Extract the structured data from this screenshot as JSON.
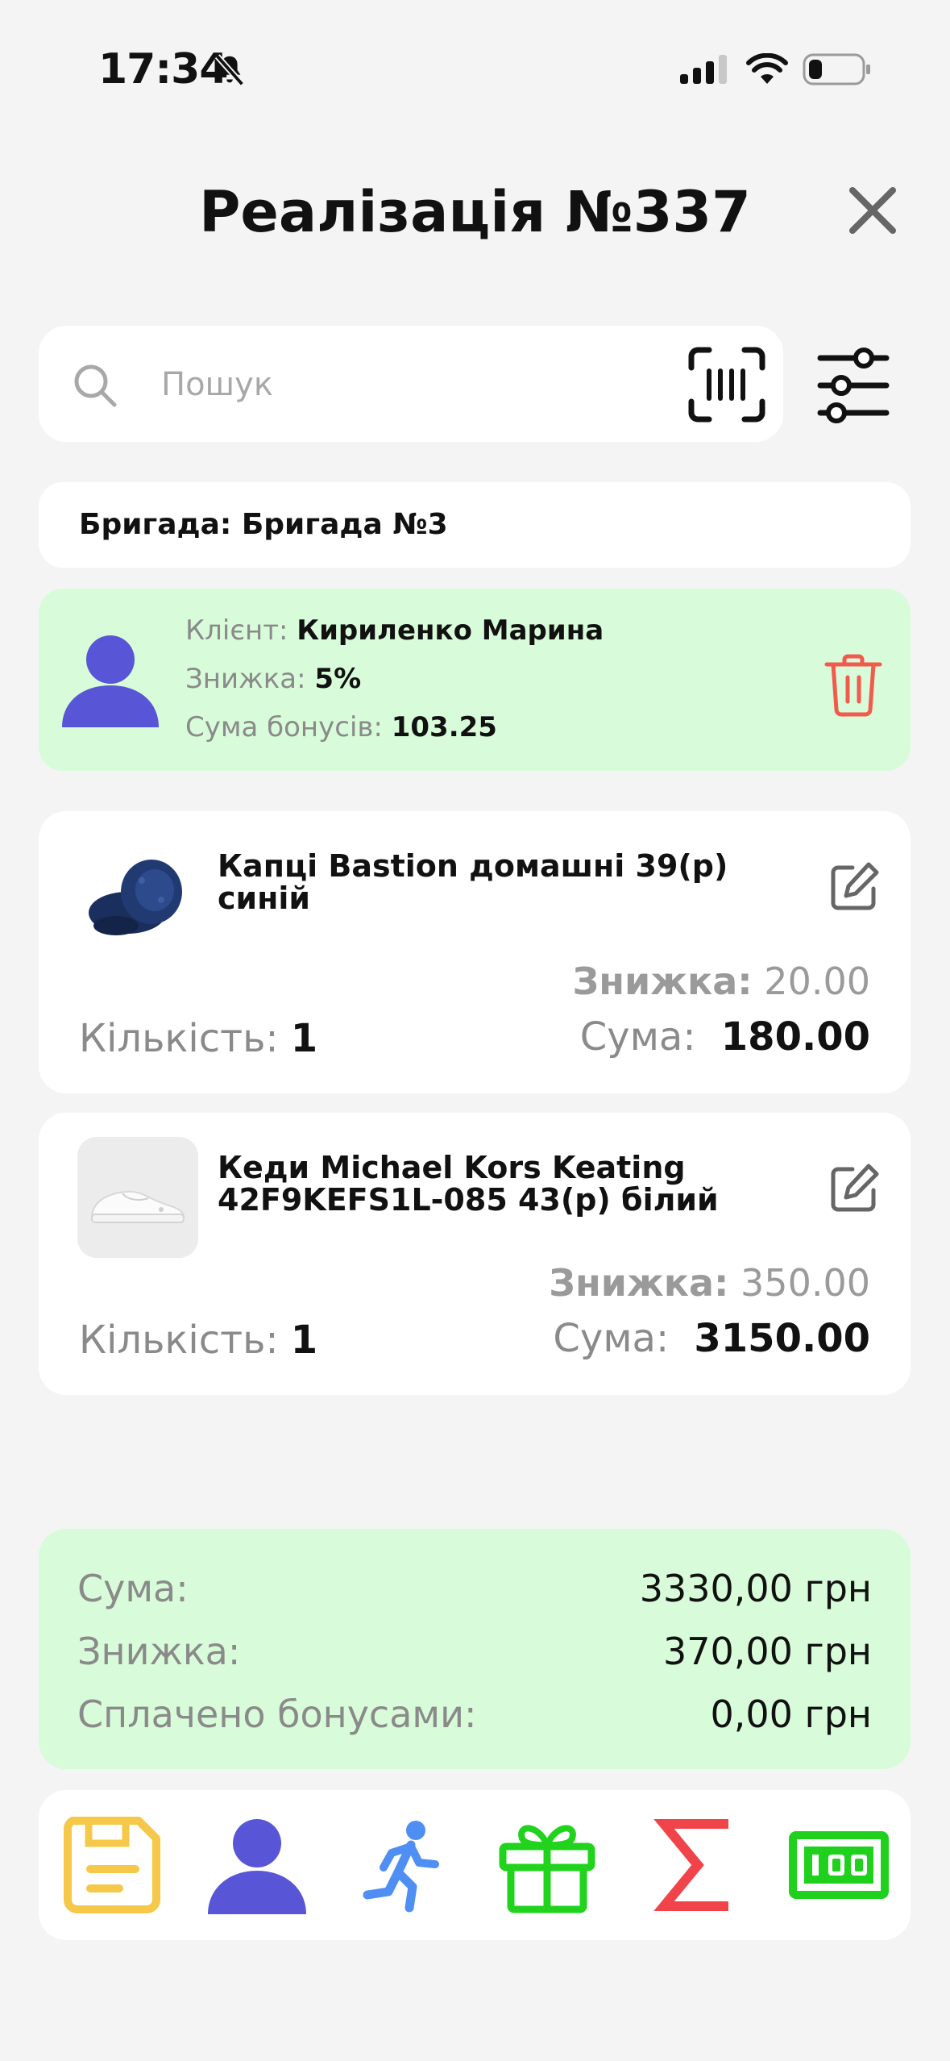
{
  "status_bar": {
    "time": "17:34"
  },
  "header": {
    "title": "Реалізація №337"
  },
  "search": {
    "placeholder": "Пошук",
    "value": ""
  },
  "brigade": {
    "text": "Бригада: Бригада №3"
  },
  "client": {
    "name_label": "Клієнт:",
    "name": "Кириленко Марина",
    "discount_label": "Знижка:",
    "discount": "5%",
    "bonus_label": "Сума бонусів:",
    "bonus": "103.25"
  },
  "products": [
    {
      "name": "Капці Bastion домашні 39(р) синій",
      "discount_label": "Знижка:",
      "discount": "20.00",
      "qty_label": "Кількість:",
      "qty": "1",
      "sum_label": "Сума:",
      "sum": "180.00"
    },
    {
      "name": "Кеди Michael Kors Keating 42F9KEFS1L-085 43(р) білий",
      "discount_label": "Знижка:",
      "discount": "350.00",
      "qty_label": "Кількість:",
      "qty": "1",
      "sum_label": "Сума:",
      "sum": "3150.00"
    }
  ],
  "totals": {
    "sum_label": "Сума:",
    "sum": "3330,00 грн",
    "discount_label": "Знижка:",
    "discount": "370,00 грн",
    "bonus_label": "Сплачено бонусами:",
    "bonus": "0,00 грн"
  },
  "toolbar": {
    "icons": [
      "save-icon",
      "client-icon",
      "runner-icon",
      "gift-icon",
      "sigma-icon",
      "cash-icon"
    ]
  },
  "colors": {
    "background": "#f4f4f4",
    "card": "#ffffff",
    "highlight_green": "#d8fcd9",
    "avatar_purple": "#5856d6",
    "delete_red": "#f25a4e",
    "save_yellow": "#f5c84a",
    "runner_blue": "#4f8ef2",
    "gift_green": "#22d31e",
    "sigma_red": "#f0444a",
    "cash_green": "#1fd11c"
  }
}
